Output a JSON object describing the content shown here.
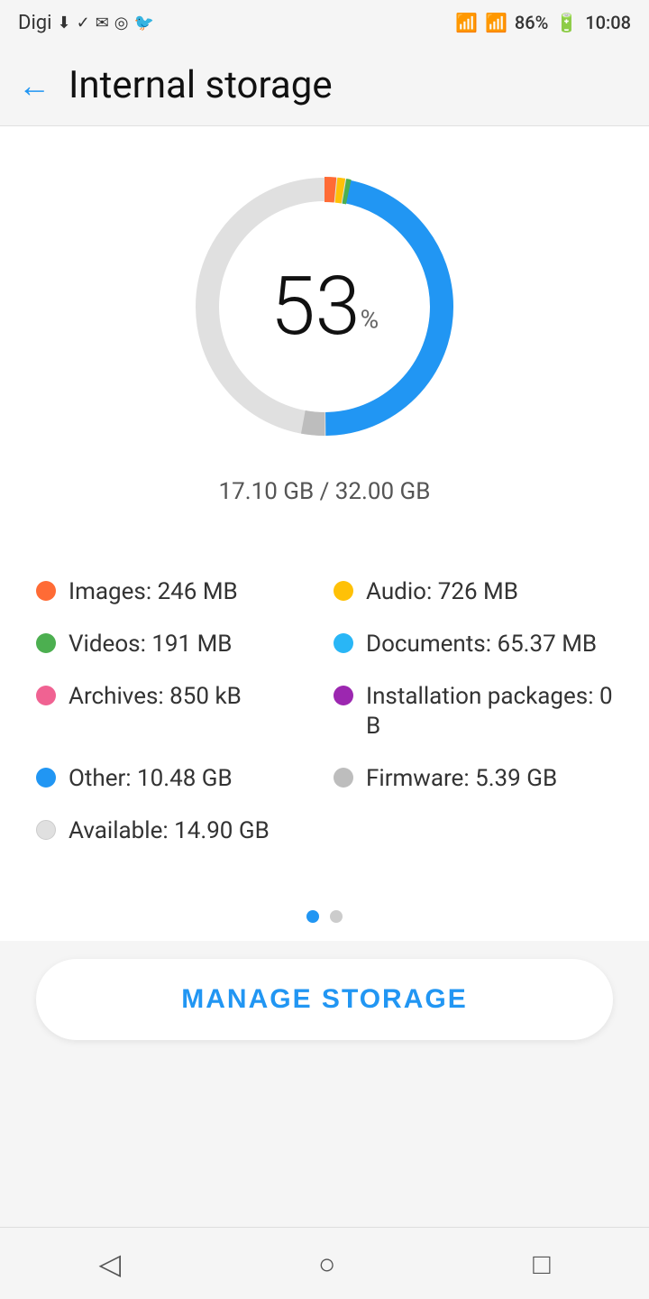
{
  "statusBar": {
    "carrier": "Digi",
    "time": "10:08",
    "battery": "86%",
    "signal": "▲↓ ✓ M ◎ 🐦"
  },
  "header": {
    "title": "Internal storage",
    "backLabel": "←"
  },
  "chart": {
    "percent": "53",
    "percentSign": "%",
    "used": "17.10 GB",
    "total": "32.00 GB",
    "storageText": "17.10 GB / 32.00 GB"
  },
  "legend": {
    "items": [
      {
        "label": "Images: 246 MB",
        "color": "#FF6B35",
        "side": "left"
      },
      {
        "label": "Audio: 726 MB",
        "color": "#FFC107",
        "side": "right"
      },
      {
        "label": "Videos: 191 MB",
        "color": "#4CAF50",
        "side": "left"
      },
      {
        "label": "Documents: 65.37 MB",
        "color": "#29B6F6",
        "side": "right"
      },
      {
        "label": "Archives: 850 kB",
        "color": "#F06292",
        "side": "left"
      },
      {
        "label": "Installation packages: 0 B",
        "color": "#9C27B0",
        "side": "right"
      },
      {
        "label": "Other: 10.48 GB",
        "color": "#2196F3",
        "side": "left"
      },
      {
        "label": "Firmware: 5.39 GB",
        "color": "#BDBDBD",
        "side": "right"
      },
      {
        "label": "Available: 14.90 GB",
        "color": "#E0E0E0",
        "side": "left"
      }
    ]
  },
  "manageButton": {
    "label": "MANAGE STORAGE"
  },
  "donut": {
    "usedPercent": 53,
    "segments": [
      {
        "value": 1.5,
        "color": "#FF6B35"
      },
      {
        "value": 1.0,
        "color": "#FFC107"
      },
      {
        "value": 0.5,
        "color": "#4CAF50"
      },
      {
        "value": 47,
        "color": "#2196F3"
      },
      {
        "value": 3,
        "color": "#BDBDBD"
      }
    ]
  }
}
